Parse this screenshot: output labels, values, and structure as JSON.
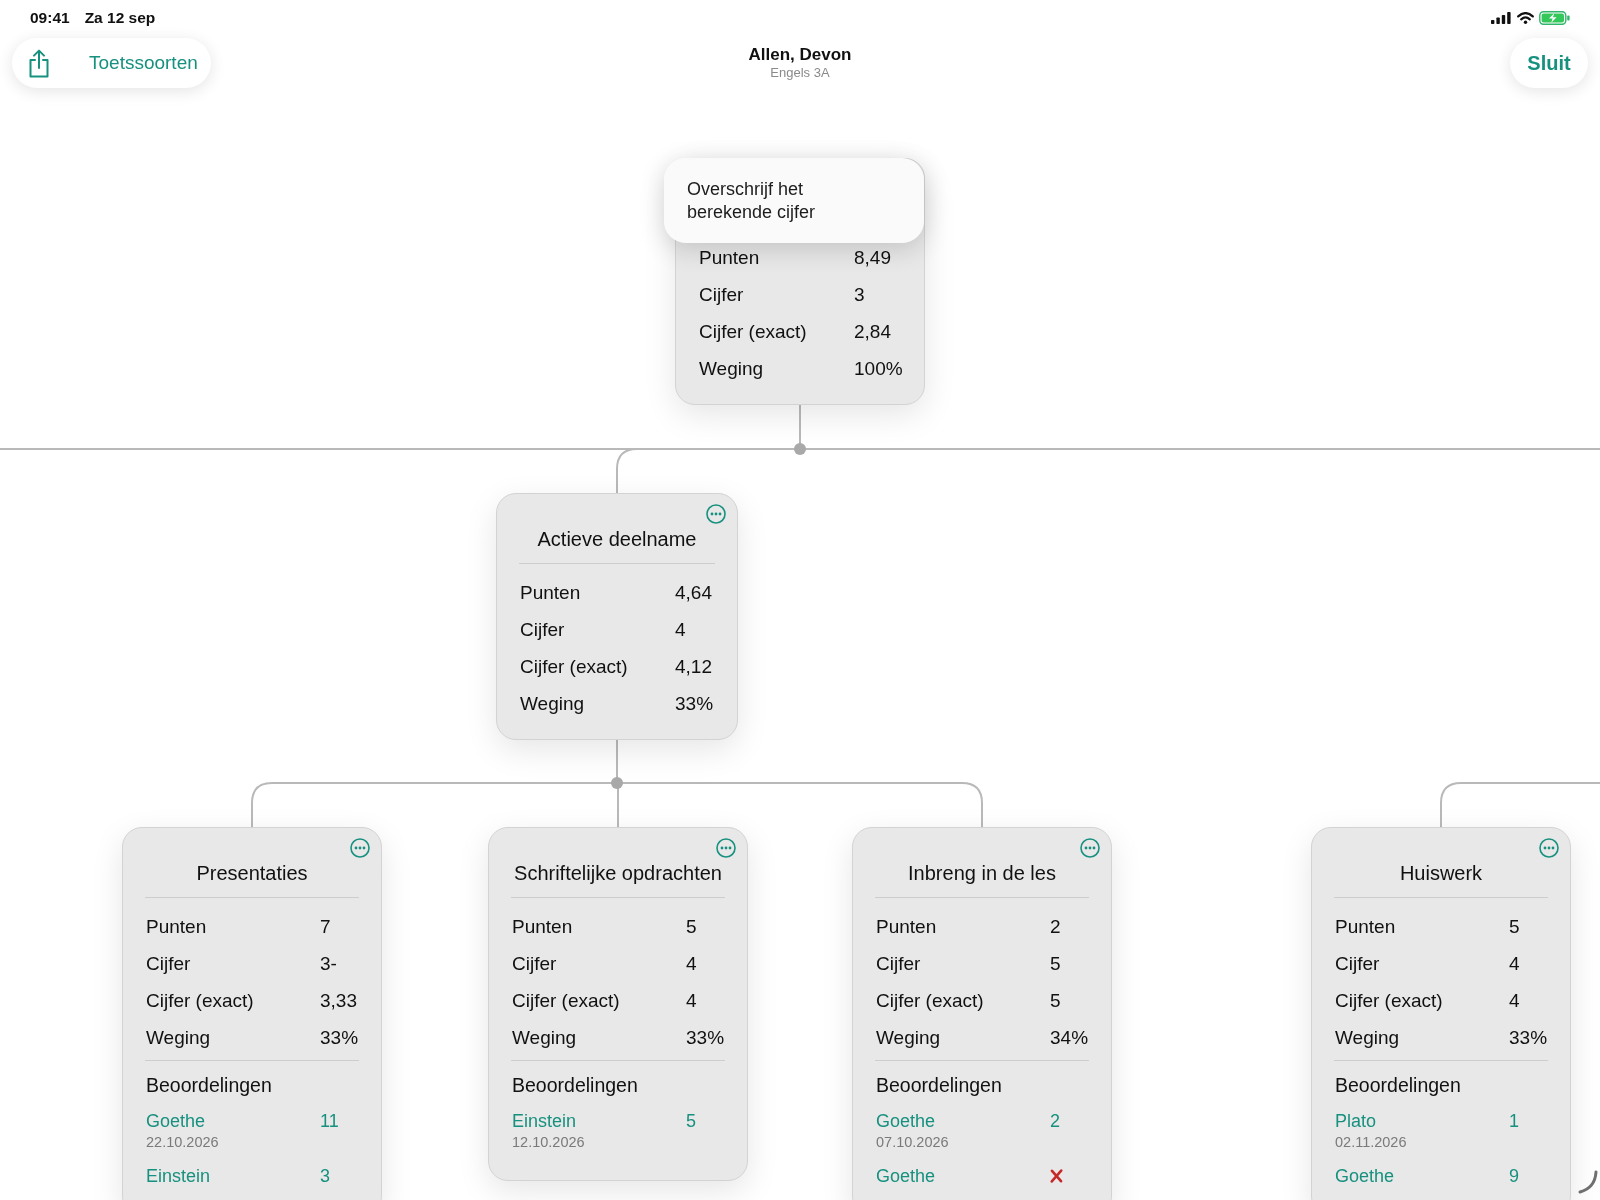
{
  "status_bar": {
    "time": "09:41",
    "date": "Za 12 sep"
  },
  "nav_bar": {
    "back_button": {
      "label": "Toetssoorten"
    },
    "title": "Allen, Devon",
    "subtitle": "Engels 3A",
    "close_button": {
      "label": "Sluit"
    }
  },
  "tree": {
    "root": {
      "menu_item": "Overschrijf het berekende cijfer",
      "stats": [
        {
          "label": "Punten",
          "value": "8,49"
        },
        {
          "label": "Cijfer",
          "value": "3"
        },
        {
          "label": "Cijfer (exact)",
          "value": "2,84"
        },
        {
          "label": "Weging",
          "value": "100%"
        }
      ],
      "children": [
        {
          "title": "Actieve deelname",
          "stats": [
            {
              "label": "Punten",
              "value": "4,64"
            },
            {
              "label": "Cijfer",
              "value": "4"
            },
            {
              "label": "Cijfer (exact)",
              "value": "4,12"
            },
            {
              "label": "Weging",
              "value": "33%"
            }
          ],
          "children": [
            {
              "title": "Presentaties",
              "stats": [
                {
                  "label": "Punten",
                  "value": "7"
                },
                {
                  "label": "Cijfer",
                  "value": "3-"
                },
                {
                  "label": "Cijfer (exact)",
                  "value": "3,33"
                },
                {
                  "label": "Weging",
                  "value": "33%"
                }
              ],
              "ratings_heading": "Beoordelingen",
              "ratings": [
                {
                  "kind": "grade",
                  "name": "Goethe",
                  "grade": "11",
                  "date": "22.10.2026"
                },
                {
                  "kind": "grade",
                  "name": "Einstein",
                  "grade": "3"
                }
              ]
            },
            {
              "title": "Schriftelijke opdrachten",
              "stats": [
                {
                  "label": "Punten",
                  "value": "5"
                },
                {
                  "label": "Cijfer",
                  "value": "4"
                },
                {
                  "label": "Cijfer (exact)",
                  "value": "4"
                },
                {
                  "label": "Weging",
                  "value": "33%"
                }
              ],
              "ratings_heading": "Beoordelingen",
              "ratings": [
                {
                  "kind": "grade",
                  "name": "Einstein",
                  "grade": "5",
                  "date": "12.10.2026"
                }
              ]
            },
            {
              "title": "Inbreng in de les",
              "stats": [
                {
                  "label": "Punten",
                  "value": "2"
                },
                {
                  "label": "Cijfer",
                  "value": "5"
                },
                {
                  "label": "Cijfer (exact)",
                  "value": "5"
                },
                {
                  "label": "Weging",
                  "value": "34%"
                }
              ],
              "ratings_heading": "Beoordelingen",
              "ratings": [
                {
                  "kind": "grade",
                  "name": "Goethe",
                  "grade": "2",
                  "date": "07.10.2026"
                },
                {
                  "kind": "missing",
                  "name": "Goethe"
                }
              ]
            }
          ]
        },
        {
          "children": [
            {
              "title": "Huiswerk",
              "stats": [
                {
                  "label": "Punten",
                  "value": "5"
                },
                {
                  "label": "Cijfer",
                  "value": "4"
                },
                {
                  "label": "Cijfer (exact)",
                  "value": "4"
                },
                {
                  "label": "Weging",
                  "value": "33%"
                }
              ],
              "ratings_heading": "Beoordelingen",
              "ratings": [
                {
                  "kind": "grade",
                  "name": "Plato",
                  "grade": "1",
                  "date": "02.11.2026"
                },
                {
                  "kind": "grade",
                  "name": "Goethe",
                  "grade": "9"
                }
              ]
            }
          ]
        }
      ]
    }
  }
}
